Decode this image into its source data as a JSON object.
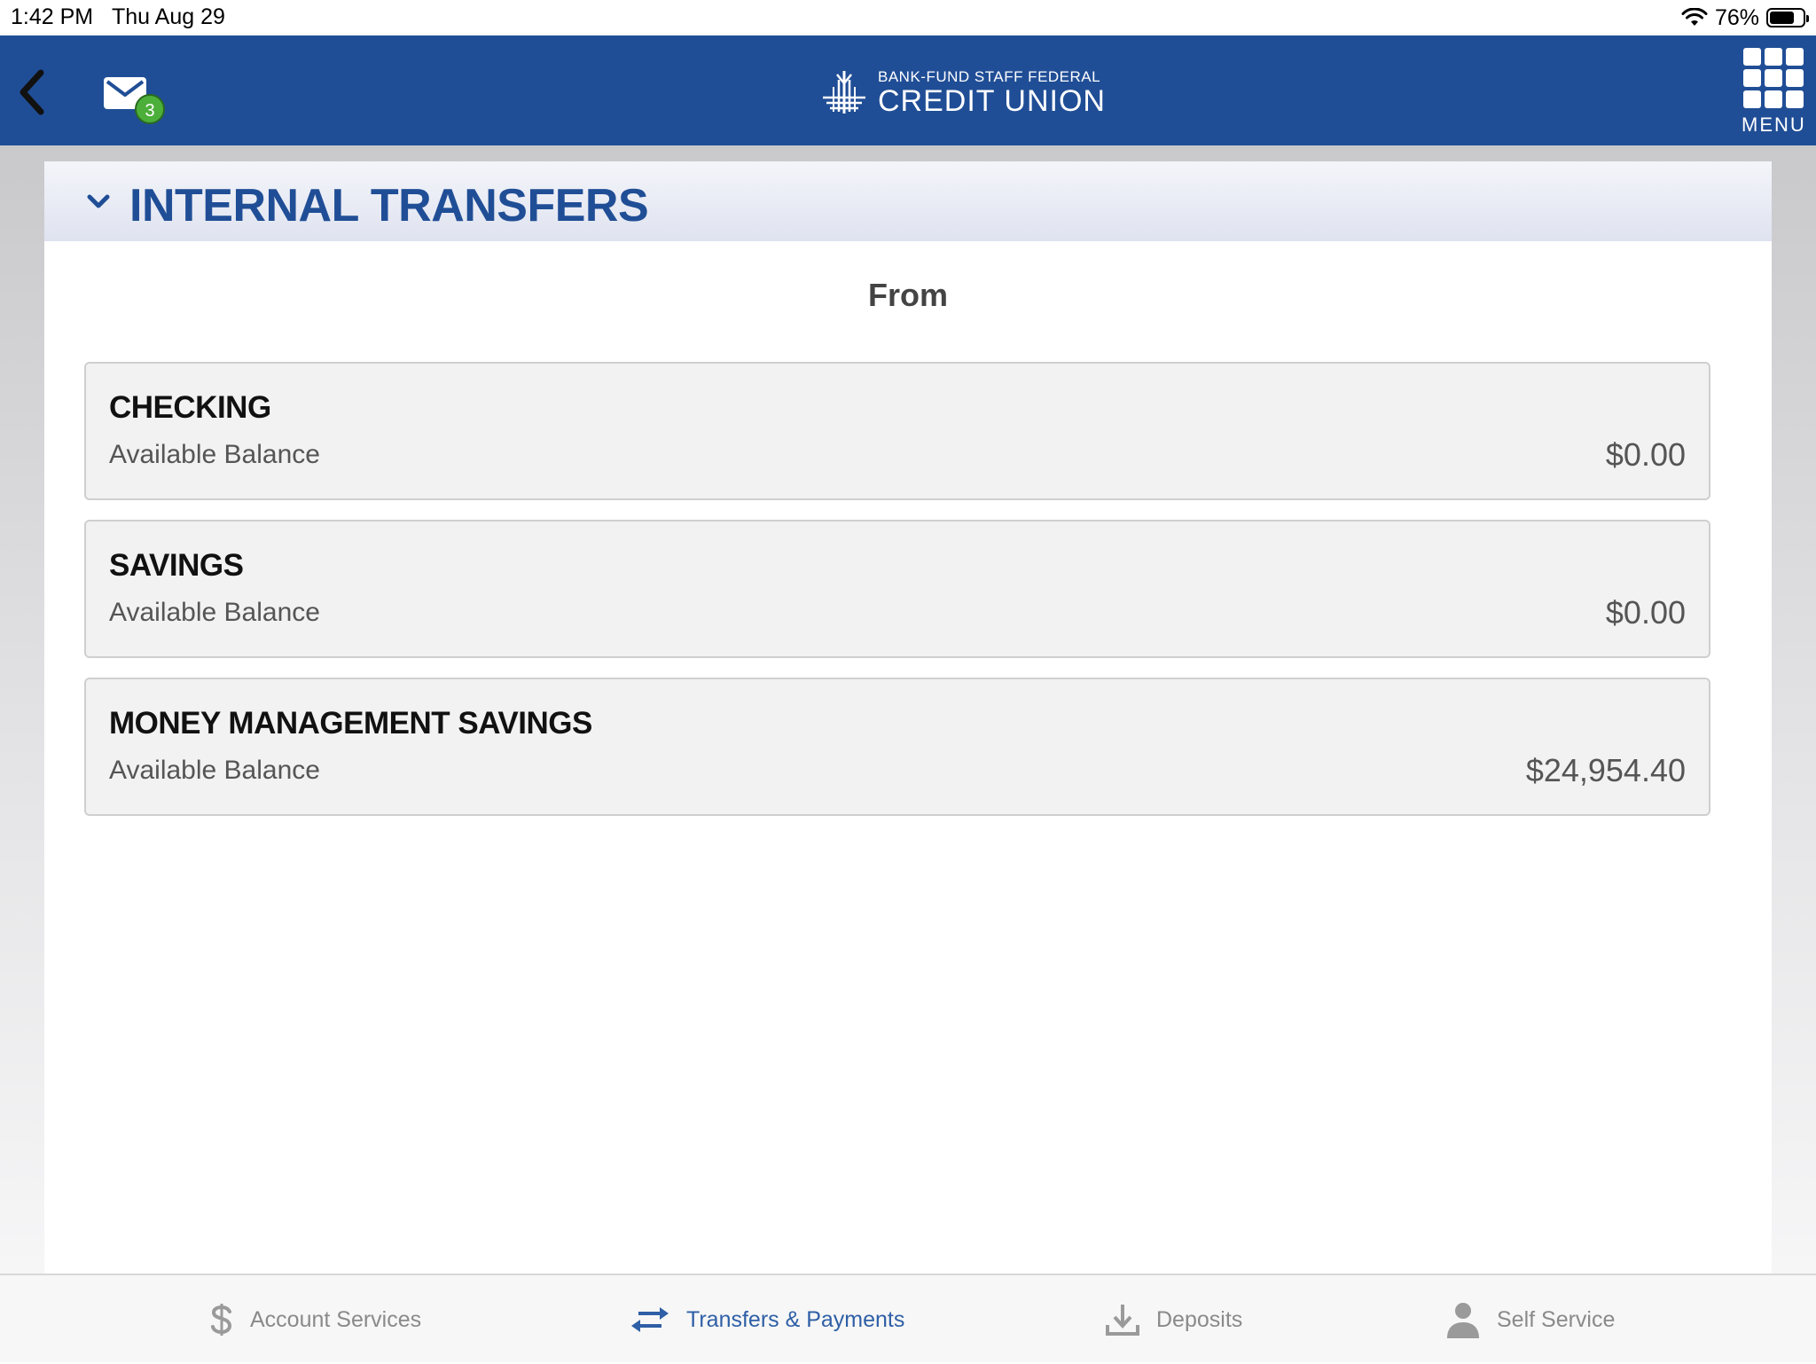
{
  "status_bar": {
    "time": "1:42 PM",
    "date": "Thu Aug 29",
    "battery_percent": "76%",
    "battery_level": 0.76
  },
  "header": {
    "mail_badge_count": "3",
    "logo": {
      "line1": "BANK-FUND STAFF FEDERAL",
      "line2": "CREDIT UNION"
    },
    "menu_label": "MENU"
  },
  "section": {
    "title": "INTERNAL TRANSFERS",
    "from_label": "From"
  },
  "accounts": [
    {
      "name": "CHECKING",
      "balance_label": "Available Balance",
      "amount": "$0.00"
    },
    {
      "name": "SAVINGS",
      "balance_label": "Available Balance",
      "amount": "$0.00"
    },
    {
      "name": "MONEY MANAGEMENT SAVINGS",
      "balance_label": "Available Balance",
      "amount": "$24,954.40"
    }
  ],
  "tabs": [
    {
      "label": "Account Services",
      "icon": "dollar-icon",
      "active": false
    },
    {
      "label": "Transfers & Payments",
      "icon": "transfer-arrows-icon",
      "active": true
    },
    {
      "label": "Deposits",
      "icon": "download-icon",
      "active": false
    },
    {
      "label": "Self Service",
      "icon": "person-icon",
      "active": false
    }
  ],
  "colors": {
    "header_blue": "#204e96",
    "active_tab": "#2f5fa6",
    "inactive_tab": "#8a8a8a",
    "badge_green": "#4caf3a"
  }
}
